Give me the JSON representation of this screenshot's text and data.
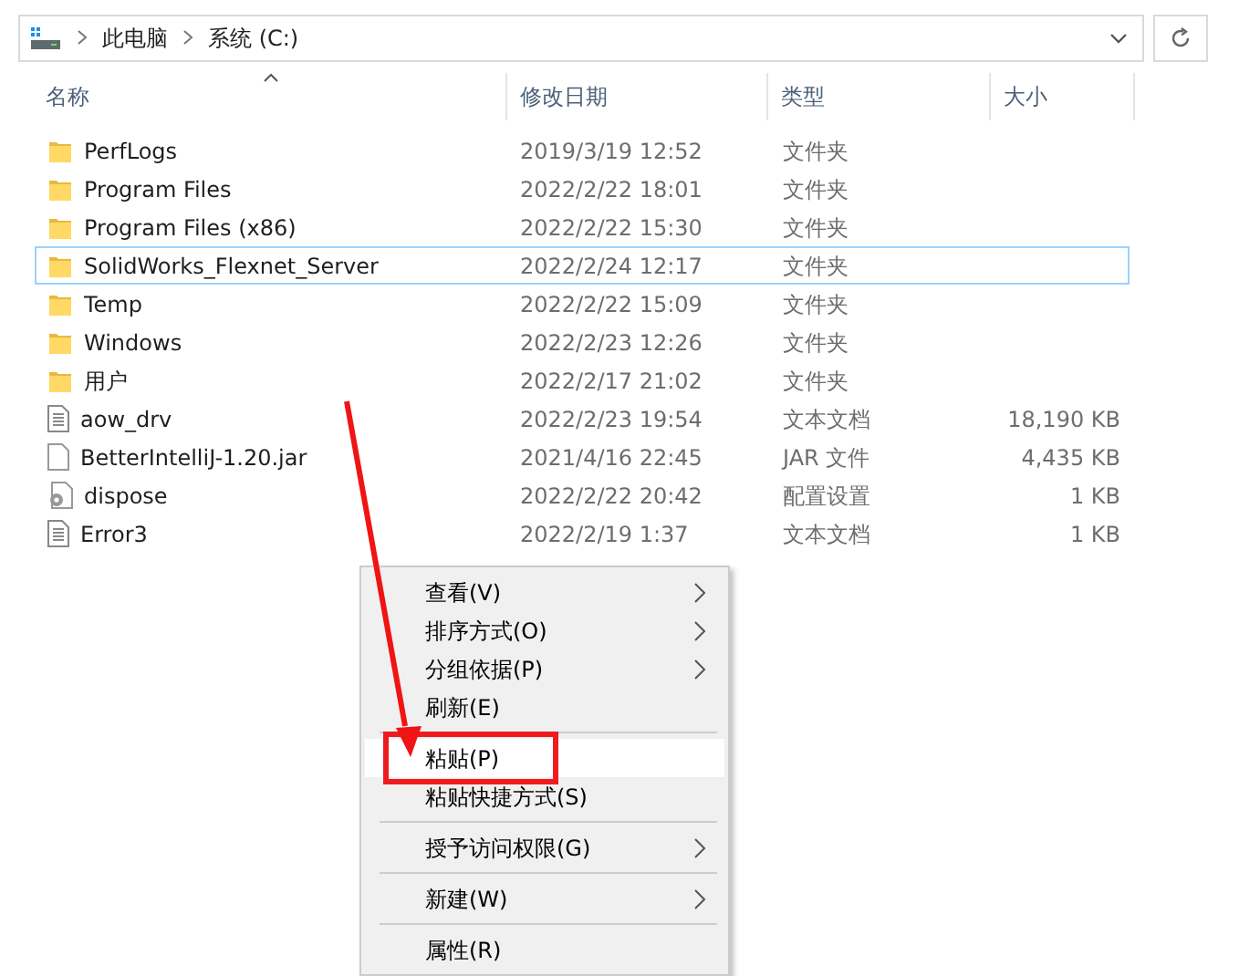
{
  "address": {
    "path": [
      "此电脑",
      "系统 (C:)"
    ]
  },
  "columns": [
    {
      "label": "名称",
      "sorted": true
    },
    {
      "label": "修改日期",
      "sorted": false
    },
    {
      "label": "类型",
      "sorted": false
    },
    {
      "label": "大小",
      "sorted": false
    }
  ],
  "files": [
    {
      "kind": "folder",
      "name": "PerfLogs",
      "date": "2019/3/19 12:52",
      "type": "文件夹",
      "focused": false
    },
    {
      "kind": "folder",
      "name": "Program Files",
      "date": "2022/2/22 18:01",
      "type": "文件夹",
      "focused": false
    },
    {
      "kind": "folder",
      "name": "Program Files (x86)",
      "date": "2022/2/22 15:30",
      "type": "文件夹",
      "focused": false
    },
    {
      "kind": "folder",
      "name": "SolidWorks_Flexnet_Server",
      "date": "2022/2/24 12:17",
      "type": "文件夹",
      "focused": true
    },
    {
      "kind": "folder",
      "name": "Temp",
      "date": "2022/2/22 15:09",
      "type": "文件夹",
      "focused": false
    },
    {
      "kind": "folder",
      "name": "Windows",
      "date": "2022/2/23 12:26",
      "type": "文件夹",
      "focused": false
    },
    {
      "kind": "folder",
      "name": "用户",
      "date": "2022/2/17 21:02",
      "type": "文件夹",
      "focused": false
    },
    {
      "kind": "text",
      "name": "aow_drv",
      "date": "2022/2/23 19:54",
      "type": "文本文档",
      "size": "18,190 KB",
      "focused": false
    },
    {
      "kind": "file",
      "name": "BetterIntelliJ-1.20.jar",
      "date": "2021/4/16 22:45",
      "type": "JAR 文件",
      "size": "4,435 KB",
      "focused": false
    },
    {
      "kind": "config",
      "name": "dispose",
      "date": "2022/2/22 20:42",
      "type": "配置设置",
      "size": "1 KB",
      "focused": false
    },
    {
      "kind": "text",
      "name": "Error3",
      "date": "2022/2/19 1:37",
      "type": "文本文档",
      "size": "1 KB",
      "focused": false
    }
  ],
  "context_menu": [
    {
      "kind": "item",
      "label": "查看(V)",
      "submenu": true,
      "highlighted": false,
      "boxed": false
    },
    {
      "kind": "item",
      "label": "排序方式(O)",
      "submenu": true,
      "highlighted": false,
      "boxed": false
    },
    {
      "kind": "item",
      "label": "分组依据(P)",
      "submenu": true,
      "highlighted": false,
      "boxed": false
    },
    {
      "kind": "item",
      "label": "刷新(E)",
      "submenu": false,
      "highlighted": false,
      "boxed": false
    },
    {
      "kind": "separator"
    },
    {
      "kind": "item",
      "label": "粘贴(P)",
      "submenu": false,
      "highlighted": true,
      "boxed": true
    },
    {
      "kind": "item",
      "label": "粘贴快捷方式(S)",
      "submenu": false,
      "highlighted": false,
      "boxed": false
    },
    {
      "kind": "separator"
    },
    {
      "kind": "item",
      "label": "授予访问权限(G)",
      "submenu": true,
      "highlighted": false,
      "boxed": false
    },
    {
      "kind": "separator"
    },
    {
      "kind": "item",
      "label": "新建(W)",
      "submenu": true,
      "highlighted": false,
      "boxed": false
    },
    {
      "kind": "separator"
    },
    {
      "kind": "item",
      "label": "属性(R)",
      "submenu": false,
      "highlighted": false,
      "boxed": false
    }
  ]
}
